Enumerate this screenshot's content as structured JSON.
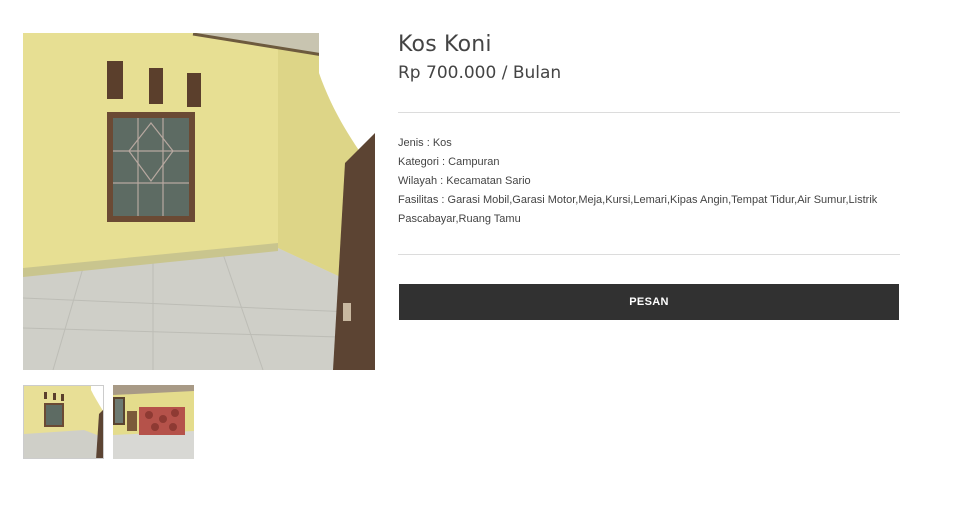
{
  "listing": {
    "title": "Kos Koni",
    "price": "Rp 700.000 / Bulan"
  },
  "details": {
    "jenis": "Jenis : Kos",
    "kategori": "Kategori : Campuran",
    "wilayah": "Wilayah : Kecamatan Sario",
    "fasilitas": "Fasilitas : Garasi Mobil,Garasi Motor,Meja,Kursi,Lemari,Kipas Angin,Tempat Tidur,Air Sumur,Listrik Pascabayar,Ruang Tamu"
  },
  "actions": {
    "order_label": "PESAN"
  },
  "gallery": {
    "thumbnails": [
      "room-photo-1",
      "room-photo-2"
    ]
  },
  "colors": {
    "button_bg": "#313131",
    "wall": "#e8e09a",
    "divider": "#dcdcdc"
  }
}
